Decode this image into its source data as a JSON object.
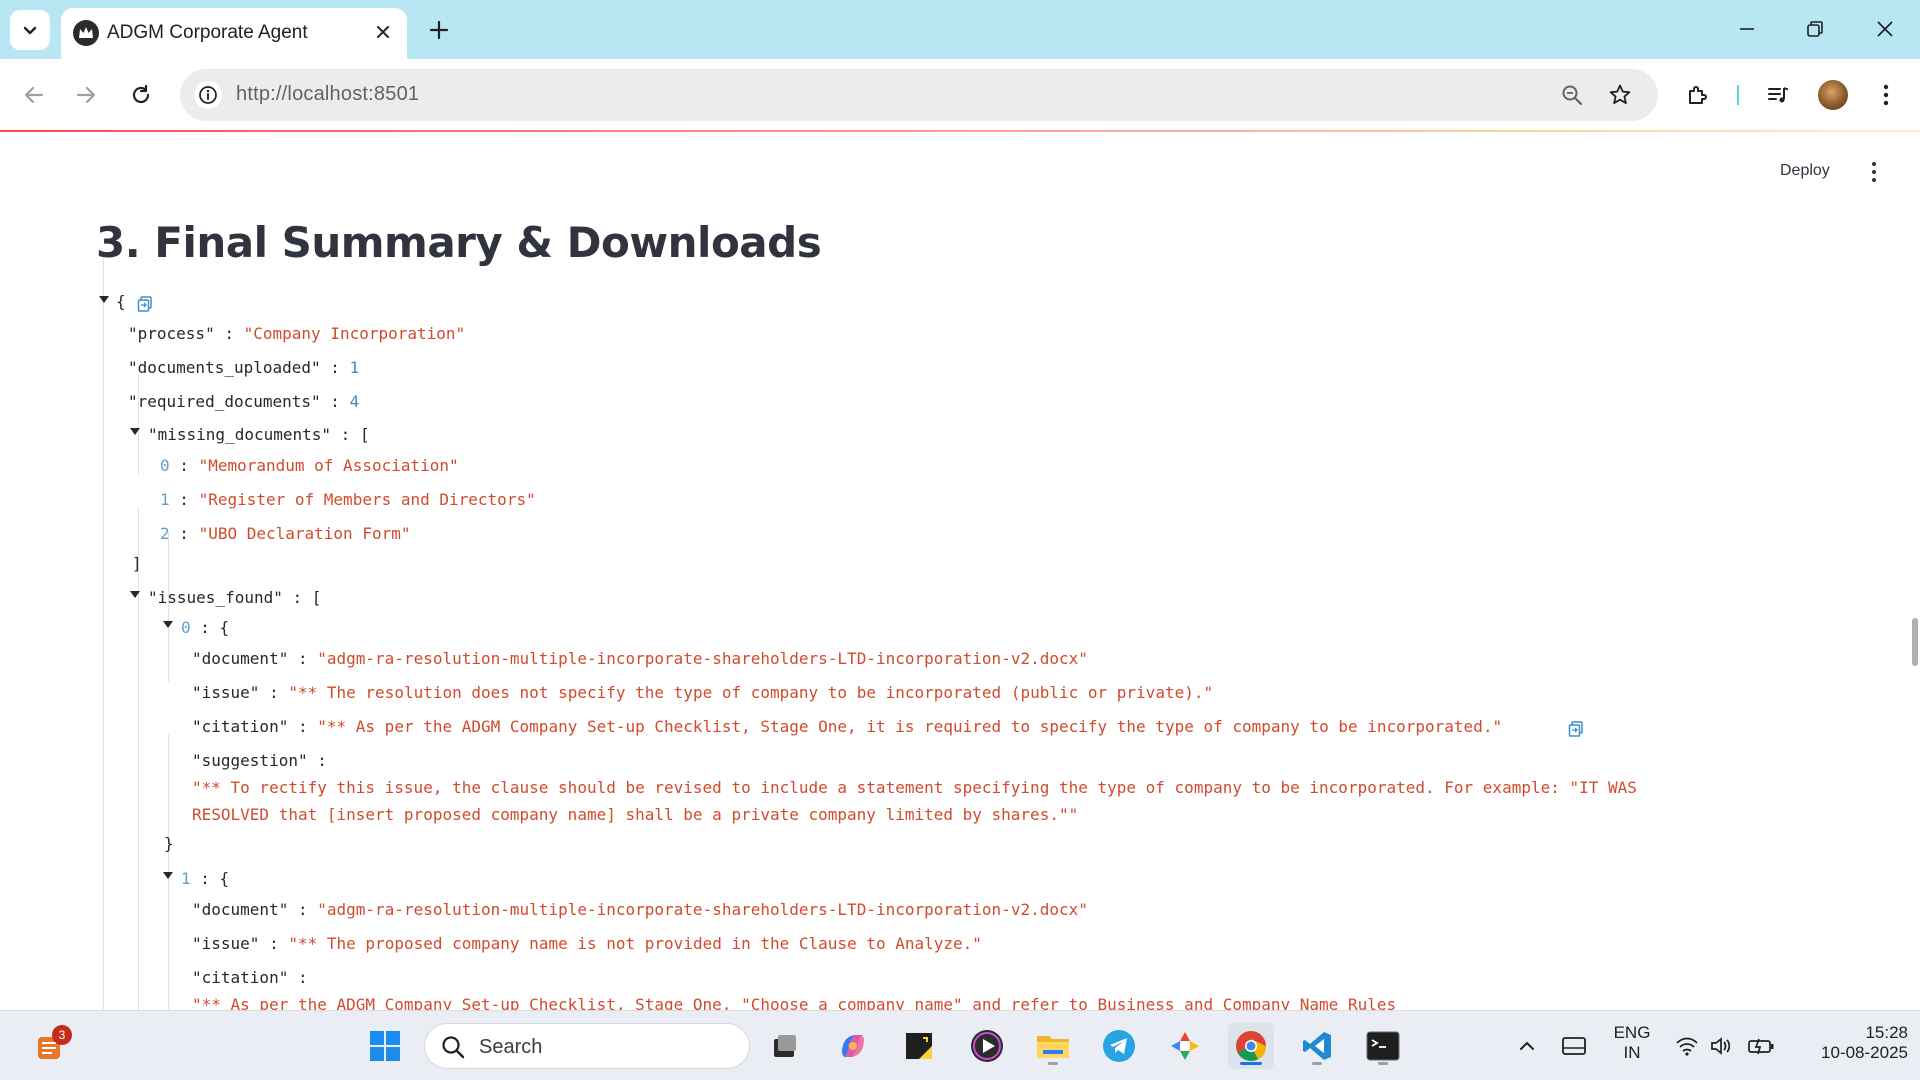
{
  "browser": {
    "tab_title": "ADGM Corporate Agent",
    "url": "http://localhost:8501"
  },
  "app": {
    "deploy_label": "Deploy",
    "section_title": "3. Final Summary & Downloads"
  },
  "json_view": {
    "open_brace": "{",
    "process_key": "\"process\"",
    "process_value": "\"Company Incorporation\"",
    "documents_uploaded_key": "\"documents_uploaded\"",
    "documents_uploaded_value": "1",
    "required_documents_key": "\"required_documents\"",
    "required_documents_value": "4",
    "missing_documents_key": "\"missing_documents\"",
    "missing_documents": [
      {
        "index": "0",
        "value": "\"Memorandum of Association\""
      },
      {
        "index": "1",
        "value": "\"Register of Members and Directors\""
      },
      {
        "index": "2",
        "value": "\"UBO Declaration Form\""
      }
    ],
    "issues_found_key": "\"issues_found\"",
    "issue_0": {
      "index": "0",
      "document_key": "\"document\"",
      "document": "\"adgm-ra-resolution-multiple-incorporate-shareholders-LTD-incorporation-v2.docx\"",
      "issue_key": "\"issue\"",
      "issue": "\"** The resolution does not specify the type of company to be incorporated (public or private).\"",
      "citation_key": "\"citation\"",
      "citation": "\"** As per the ADGM Company Set-up Checklist, Stage One, it is required to specify the type of company to be incorporated.\"",
      "suggestion_key": "\"suggestion\"",
      "suggestion_line1": "\"** To rectify this issue, the clause should be revised to include a statement specifying the type of company to be incorporated. For example: \"IT WAS",
      "suggestion_line2": "RESOLVED that [insert proposed company name] shall be a private company limited by shares.\"\""
    },
    "issue_1": {
      "index": "1",
      "document_key": "\"document\"",
      "document": "\"adgm-ra-resolution-multiple-incorporate-shareholders-LTD-incorporation-v2.docx\"",
      "issue_key": "\"issue\"",
      "issue": "\"** The proposed company name is not provided in the Clause to Analyze.\"",
      "citation_key": "\"citation\"",
      "citation_partial": "\"** As per the ADGM Company Set-up Checklist, Stage One, \"Choose a company name\" and refer to Business and Company Name Rules"
    }
  },
  "taskbar": {
    "search_placeholder": "Search",
    "notification_count": "3",
    "language": "ENG",
    "region": "IN",
    "time": "15:28",
    "date": "10-08-2025"
  },
  "colors": {
    "tabstrip": "#b8e6f2",
    "json_string": "#d14b2d",
    "json_number": "#3a8fd0",
    "title_text": "#31333f"
  }
}
